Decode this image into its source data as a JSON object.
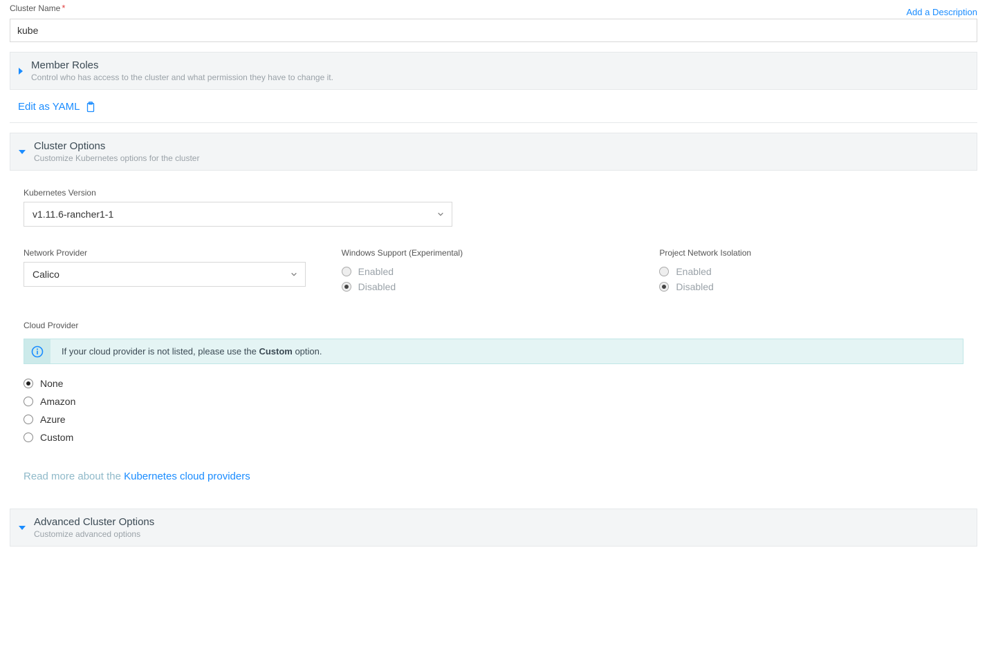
{
  "clusterName": {
    "label": "Cluster Name",
    "value": "kube",
    "addDescription": "Add a Description"
  },
  "memberRoles": {
    "title": "Member Roles",
    "desc": "Control who has access to the cluster and what permission they have to change it."
  },
  "editYaml": "Edit as YAML",
  "clusterOptions": {
    "title": "Cluster Options",
    "desc": "Customize Kubernetes options for the cluster",
    "kubeVersion": {
      "label": "Kubernetes Version",
      "value": "v1.11.6-rancher1-1"
    },
    "networkProvider": {
      "label": "Network Provider",
      "value": "Calico"
    },
    "windowsSupport": {
      "label": "Windows Support (Experimental)",
      "enabled": "Enabled",
      "disabled": "Disabled",
      "selected": "disabled",
      "active": false
    },
    "projectIsolation": {
      "label": "Project Network Isolation",
      "enabled": "Enabled",
      "disabled": "Disabled",
      "selected": "disabled",
      "active": false
    },
    "cloudProvider": {
      "label": "Cloud Provider",
      "infoPre": "If your cloud provider is not listed, please use the ",
      "infoBold": "Custom",
      "infoPost": " option.",
      "options": {
        "none": "None",
        "amazon": "Amazon",
        "azure": "Azure",
        "custom": "Custom"
      },
      "selected": "none",
      "readMorePre": "Read more about the ",
      "readMoreLink": "Kubernetes cloud providers"
    }
  },
  "advanced": {
    "title": "Advanced Cluster Options",
    "desc": "Customize advanced options"
  }
}
